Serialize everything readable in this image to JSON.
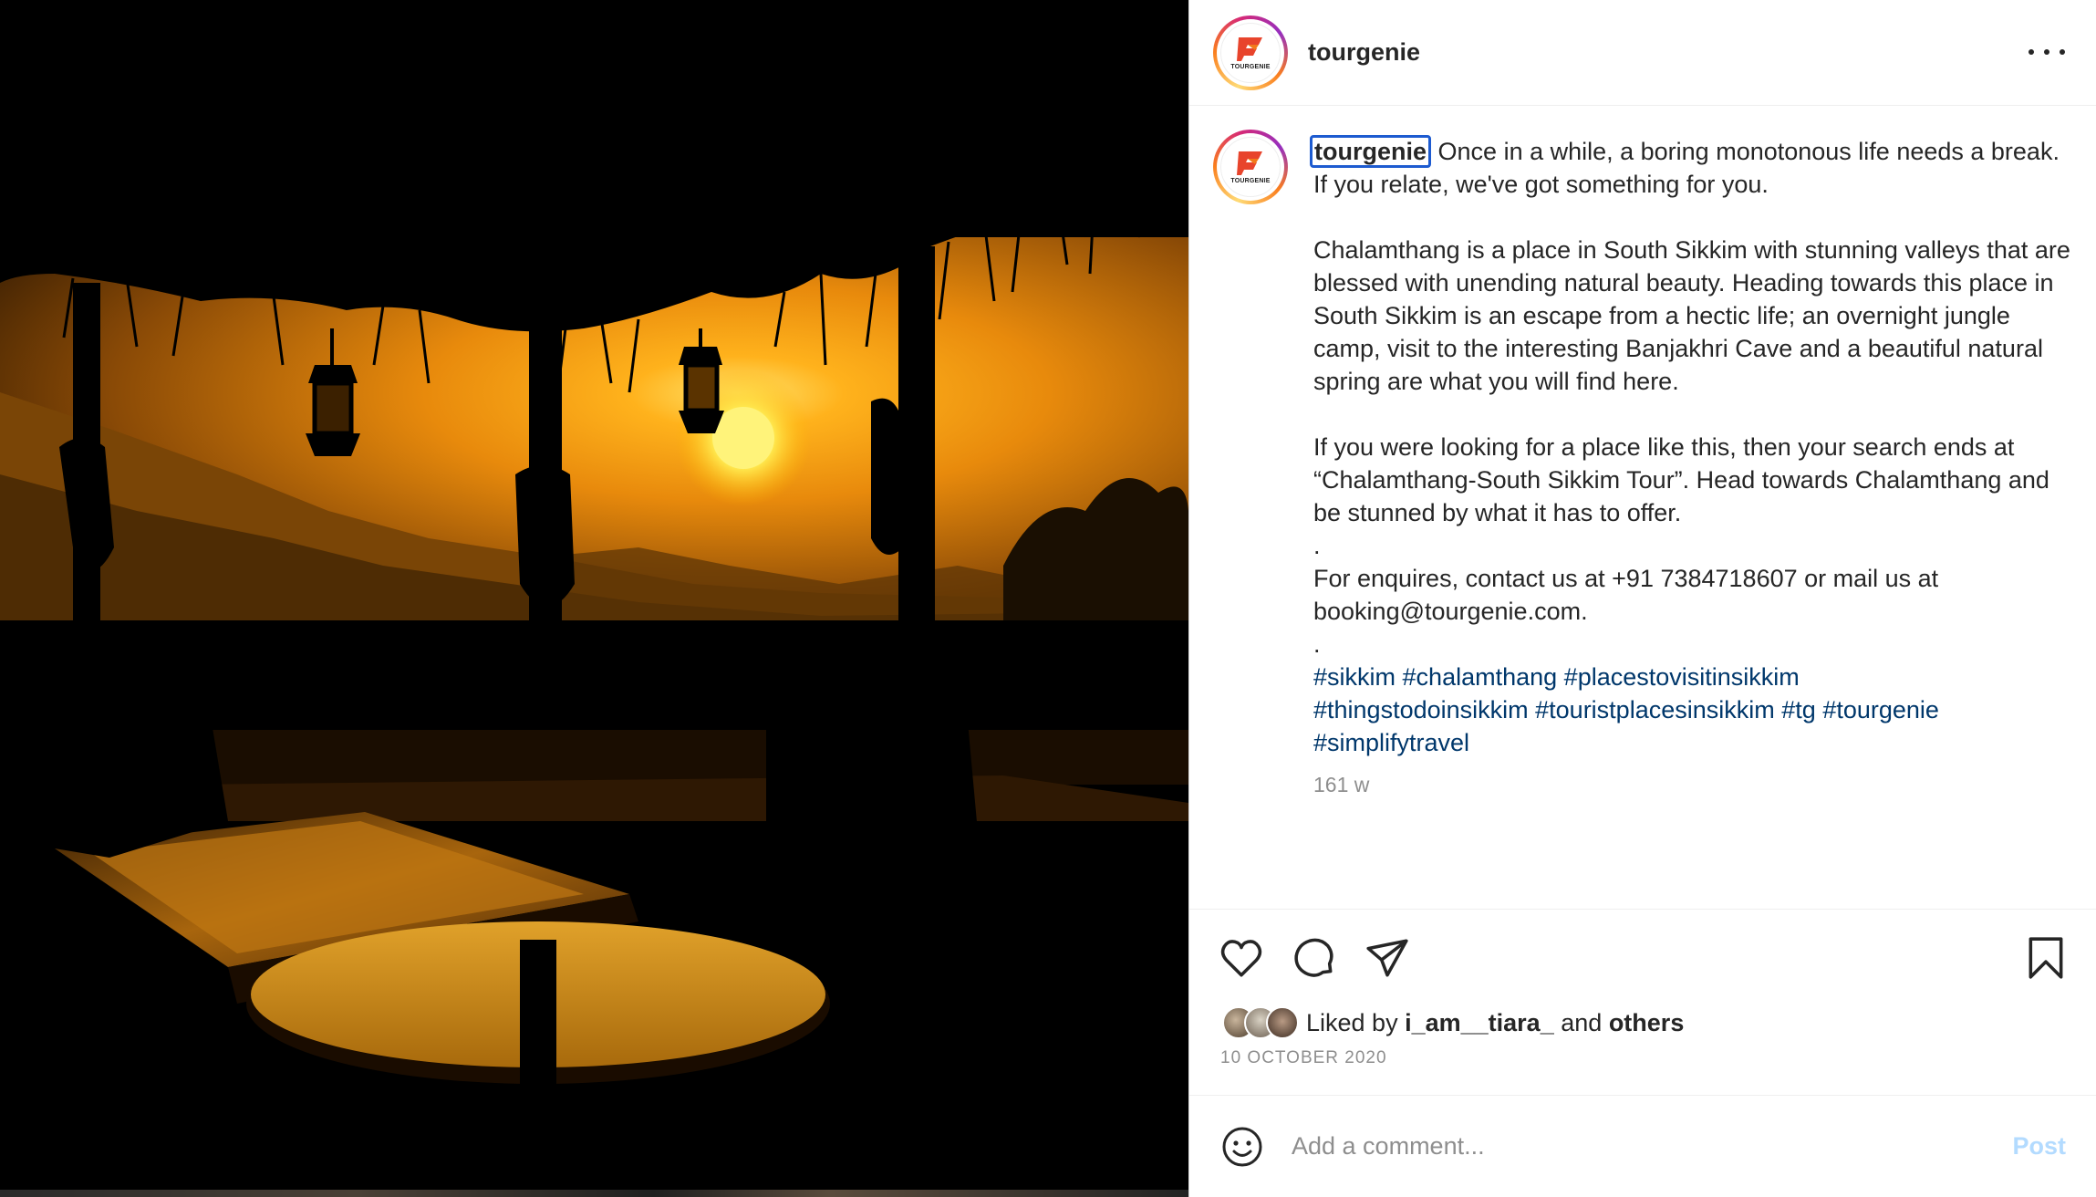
{
  "post": {
    "username": "tourgenie",
    "avatar_word": "TOURGENIE",
    "more_icon": "more-horizontal-icon"
  },
  "caption": {
    "username": "tourgenie",
    "p1": "Once in a while, a boring monotonous life needs a break. If you relate, we've got something for you.",
    "p2": "Chalamthang is a place in South Sikkim with stunning valleys that are blessed with unending natural beauty. Heading towards this place in South Sikkim is an escape from a hectic life; an overnight jungle camp, visit to the interesting Banjakhri Cave and a beautiful natural spring are what you will find here.",
    "p3": "If you were looking for a place like this, then your search ends at “Chalamthang-South Sikkim Tour”. Head towards Chalamthang and be stunned by what it has to offer.",
    "dot1": ".",
    "p4": "For enquires, contact us at +91 7384718607 or mail us at booking@tourgenie.com.",
    "dot2": ".",
    "hashtags": [
      "#sikkim",
      "#chalamthang",
      "#placestovisitinsikkim",
      "#thingstodoinsikkim",
      "#touristplacesinsikkim",
      "#tg",
      "#tourgenie",
      "#simplifytravel"
    ],
    "time": "161 w"
  },
  "actions": {
    "liked_by_prefix": "Liked by",
    "liked_by_user": "i_am__tiara_",
    "and": "and",
    "others": "others",
    "date": "10 OCTOBER 2020"
  },
  "comment": {
    "placeholder": "Add a comment...",
    "post_label": "Post"
  },
  "colors": {
    "link": "#00376b",
    "muted": "#8e8e8e",
    "post_disabled": "#b3dbff",
    "focus_outline": "#1d5bd0"
  }
}
